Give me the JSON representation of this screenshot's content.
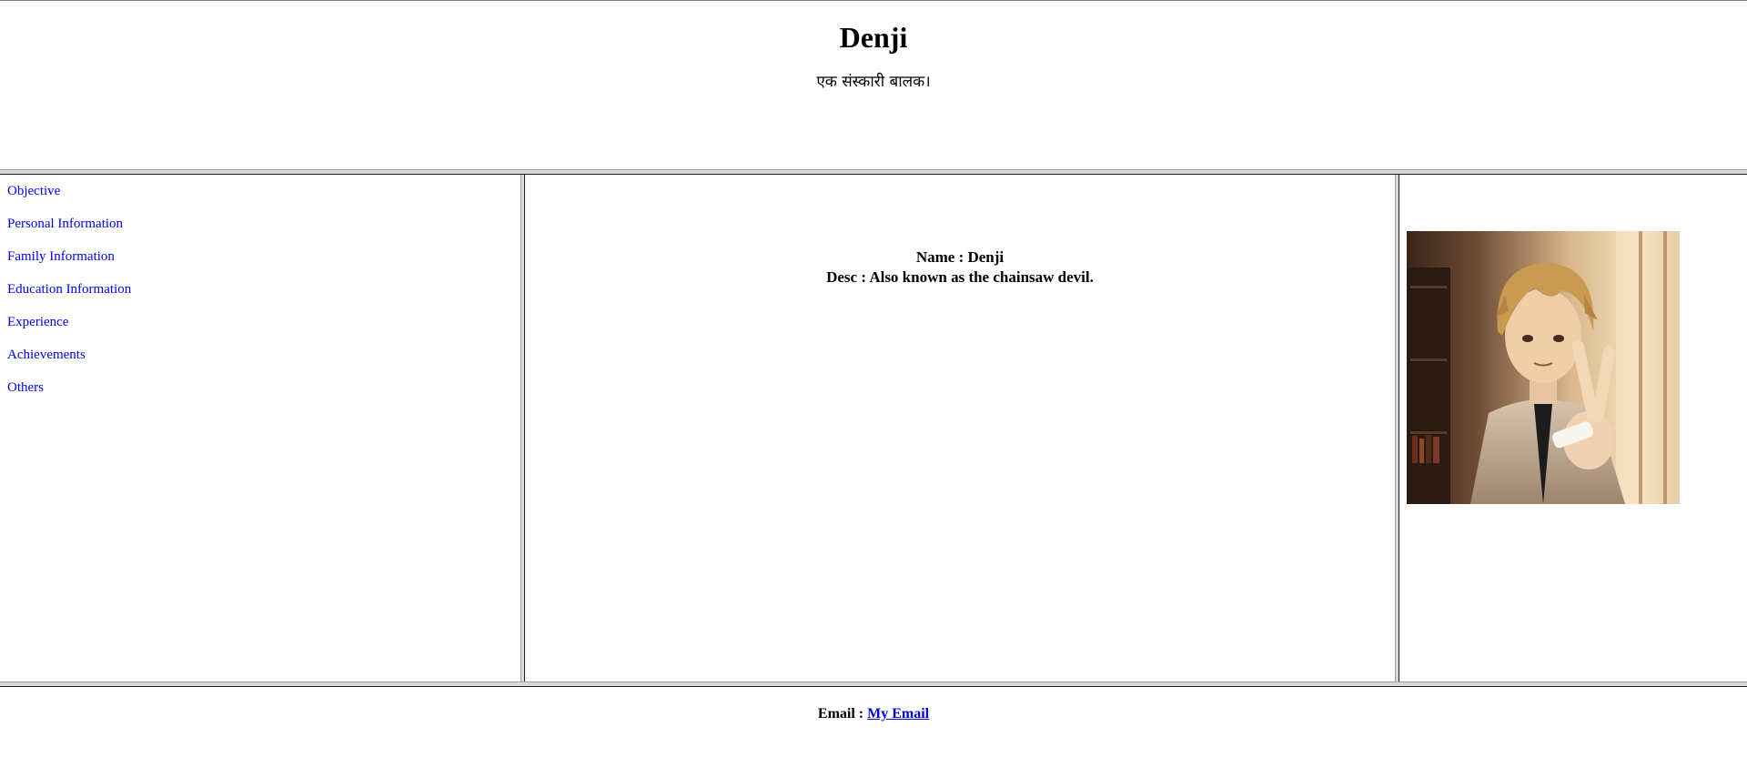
{
  "header": {
    "title": "Denji",
    "tagline": "एक संस्कारी बालक।"
  },
  "nav": {
    "items": [
      {
        "label": "Objective"
      },
      {
        "label": "Personal Information"
      },
      {
        "label": "Family Information"
      },
      {
        "label": "Education Information"
      },
      {
        "label": "Experience"
      },
      {
        "label": "Achievements"
      },
      {
        "label": "Others"
      }
    ]
  },
  "main": {
    "name_line": "Name : Denji",
    "desc_line": "Desc : Also known as the chainsaw devil."
  },
  "footer": {
    "email_label": "Email :",
    "email_link": "My Email"
  },
  "colors": {
    "link": "#0000ee",
    "frame_border": "#d9d9d9"
  }
}
